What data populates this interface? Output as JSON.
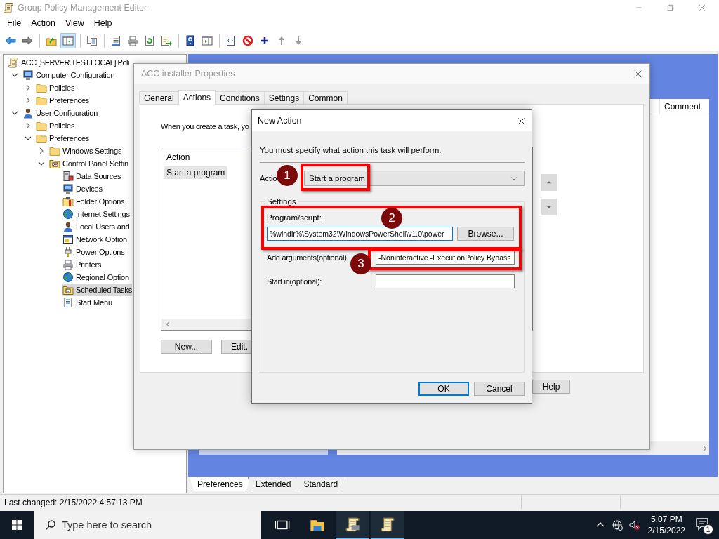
{
  "window": {
    "title": "Group Policy Management Editor"
  },
  "menu": [
    "File",
    "Action",
    "View",
    "Help"
  ],
  "toolbar": [
    [
      {
        "kind": "back",
        "pressed": false
      },
      {
        "kind": "forward",
        "pressed": false
      }
    ],
    [
      {
        "kind": "up-folder",
        "pressed": false
      },
      {
        "kind": "console-tree",
        "pressed": true
      }
    ],
    [
      {
        "kind": "copy",
        "pressed": false
      }
    ],
    [
      {
        "kind": "properties",
        "pressed": false
      },
      {
        "kind": "print",
        "pressed": false
      },
      {
        "kind": "refresh",
        "pressed": false
      },
      {
        "kind": "export",
        "pressed": false
      }
    ],
    [
      {
        "kind": "help",
        "pressed": false
      },
      {
        "kind": "action-pane",
        "pressed": false
      }
    ],
    [
      {
        "kind": "script",
        "pressed": false
      },
      {
        "kind": "stop",
        "pressed": false
      },
      {
        "kind": "add",
        "pressed": false
      },
      {
        "kind": "move-up",
        "pressed": false
      },
      {
        "kind": "move-down",
        "pressed": false
      }
    ]
  ],
  "tree": [
    {
      "label": "ACC [SERVER.TEST.LOCAL] Poli",
      "kind": "policy",
      "selected": false,
      "children": [
        {
          "label": "Computer Configuration",
          "kind": "computer",
          "expanded": true,
          "selected": false,
          "children": [
            {
              "label": "Policies",
              "kind": "folder",
              "expanded": false,
              "selected": false
            },
            {
              "label": "Preferences",
              "kind": "folder",
              "expanded": false,
              "selected": false
            }
          ]
        },
        {
          "label": "User Configuration",
          "kind": "user",
          "expanded": true,
          "selected": false,
          "children": [
            {
              "label": "Policies",
              "kind": "folder",
              "expanded": false,
              "selected": false
            },
            {
              "label": "Preferences",
              "kind": "folder",
              "expanded": true,
              "selected": false,
              "children": [
                {
                  "label": "Windows Settings",
                  "kind": "folder",
                  "expanded": false,
                  "selected": false
                },
                {
                  "label": "Control Panel Settin",
                  "kind": "control-panel",
                  "expanded": true,
                  "selected": false,
                  "children": [
                    {
                      "label": "Data Sources",
                      "kind": "data-sources",
                      "selected": false
                    },
                    {
                      "label": "Devices",
                      "kind": "devices",
                      "selected": false
                    },
                    {
                      "label": "Folder Options",
                      "kind": "folder-options",
                      "selected": false
                    },
                    {
                      "label": "Internet Settings",
                      "kind": "internet",
                      "selected": false
                    },
                    {
                      "label": "Local Users and",
                      "kind": "local-users",
                      "selected": false
                    },
                    {
                      "label": "Network Option",
                      "kind": "network",
                      "selected": false
                    },
                    {
                      "label": "Power Options",
                      "kind": "power",
                      "selected": false
                    },
                    {
                      "label": "Printers",
                      "kind": "printers",
                      "selected": false
                    },
                    {
                      "label": "Regional Option",
                      "kind": "regional",
                      "selected": false
                    },
                    {
                      "label": "Scheduled Tasks",
                      "kind": "tasks",
                      "selected": true
                    },
                    {
                      "label": "Start Menu",
                      "kind": "start-menu",
                      "selected": false
                    }
                  ]
                }
              ]
            }
          ]
        }
      ]
    }
  ],
  "results_pane": {
    "columns": [
      "Comment"
    ]
  },
  "view_tabs": [
    {
      "label": "Preferences",
      "selected": true
    },
    {
      "label": "Extended",
      "selected": false
    },
    {
      "label": "Standard",
      "selected": false
    }
  ],
  "status_bar": [
    "Last changed: 2/15/2022 4:57:13 PM"
  ],
  "properties_dialog": {
    "title": "ACC installer Properties",
    "tabs": [
      {
        "label": "General",
        "selected": false
      },
      {
        "label": "Actions",
        "selected": true
      },
      {
        "label": "Conditions",
        "selected": false
      },
      {
        "label": "Settings",
        "selected": false
      },
      {
        "label": "Common",
        "selected": false
      }
    ],
    "intro": "When you create a task, yo",
    "list": {
      "columns": [
        "Action"
      ],
      "rows": [
        {
          "label": "Start a program",
          "selected": true
        }
      ]
    },
    "buttons": [
      "New...",
      "Edit."
    ],
    "help_button": "Help"
  },
  "new_action_dialog": {
    "title": "New Action",
    "instruction": "You must specify what action this task will perform.",
    "action_label": "Actio",
    "action_value": "Start a program",
    "group_label": "Settings",
    "fields": [
      {
        "kind": "stacked",
        "label": "Program/script:",
        "value": "%windir%\\System32\\WindowsPowerShell\\v1.0\\power",
        "focused": true,
        "button": "Browse..."
      },
      {
        "kind": "inline",
        "label": "Add arguments(optional)",
        "value": "-Noninteractive -ExecutionPolicy Bypass",
        "focused": false
      },
      {
        "kind": "inline",
        "label": "Start in(optional):",
        "focused": false
      }
    ],
    "buttons": [
      {
        "label": "OK",
        "default": true
      },
      {
        "label": "Cancel",
        "default": false
      }
    ]
  },
  "annotations": [
    {
      "label": "1"
    },
    {
      "label": "2"
    },
    {
      "label": "3"
    }
  ],
  "taskbar": {
    "search": {
      "placeholder": "Type here to search"
    },
    "apps": [
      {
        "kind": "task-view",
        "active": false
      },
      {
        "kind": "file-explorer",
        "active": false
      },
      {
        "kind": "policy-editor",
        "active": true
      },
      {
        "kind": "policy",
        "active": true
      }
    ],
    "tray": [
      {
        "kind": "chevron"
      },
      {
        "kind": "network"
      },
      {
        "kind": "volume-muted"
      }
    ],
    "time": "5:07 PM",
    "date": "2/15/2022",
    "notifications": "1"
  }
}
